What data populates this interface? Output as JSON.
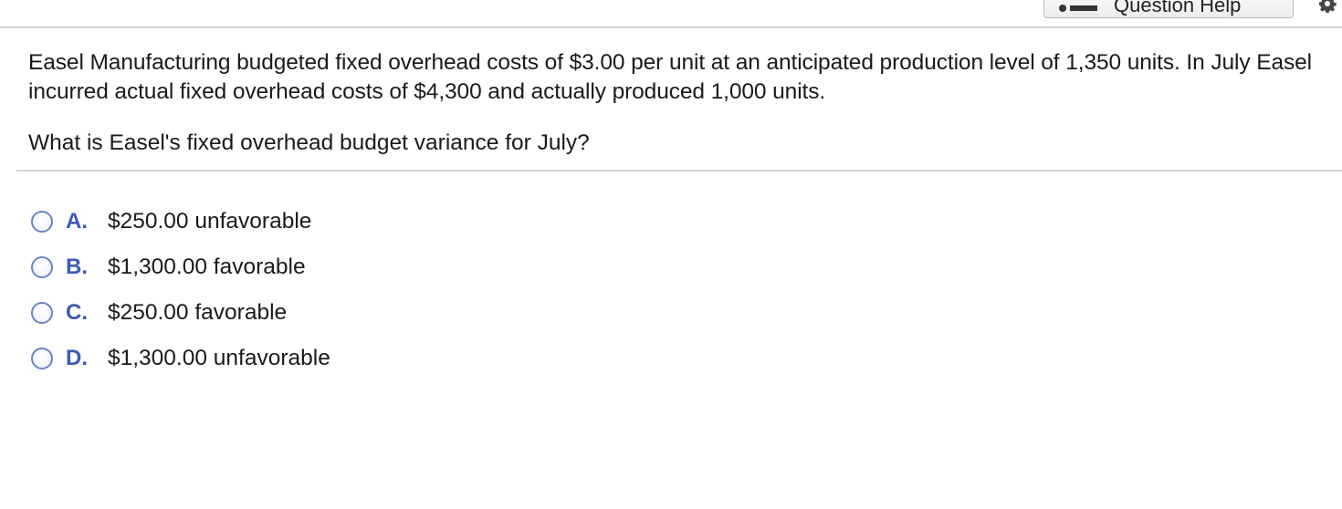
{
  "header": {
    "help_button_label": "Question Help",
    "help_icon": "help-icon",
    "settings_icon": "gear-icon"
  },
  "question": {
    "text": "Easel Manufacturing budgeted fixed overhead costs of $3.00 per unit at an anticipated production level of 1,350 units. In July Easel incurred actual fixed overhead costs of $4,300 and actually produced 1,000 units.",
    "prompt": "What is Easel's fixed overhead budget variance for July?"
  },
  "options": [
    {
      "letter": "A.",
      "text": "$250.00 unfavorable"
    },
    {
      "letter": "B.",
      "text": "$1,300.00 favorable"
    },
    {
      "letter": "C.",
      "text": "$250.00 favorable"
    },
    {
      "letter": "D.",
      "text": "$1,300.00 unfavorable"
    }
  ],
  "colors": {
    "option_letter": "#3b5bb5",
    "radio_border": "#6b84c4",
    "divider": "#d6d6d6"
  }
}
